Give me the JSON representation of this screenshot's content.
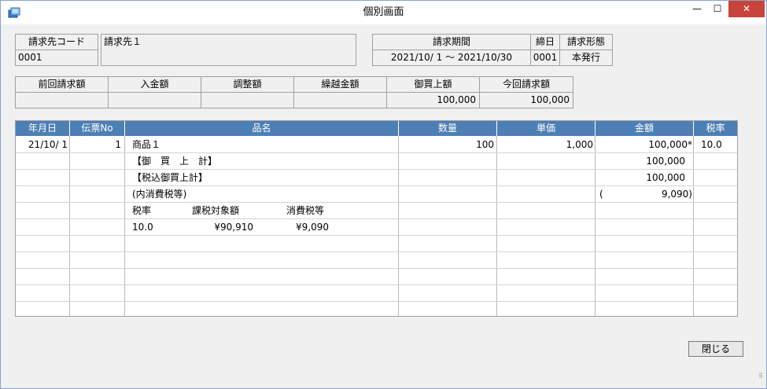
{
  "window": {
    "title": "個別画面",
    "minimize": "—",
    "maximize": "☐",
    "close": "✕",
    "icon": "app-icon"
  },
  "customer": {
    "code_label": "請求先コード",
    "code_value": "0001",
    "name_value": "請求先１"
  },
  "billing": {
    "period_label": "請求期間",
    "period_value": "2021/10/ 1 〜 2021/10/30",
    "closing_label": "締日",
    "closing_value": "0001",
    "format_label": "請求形態",
    "format_value": "本発行"
  },
  "summary": {
    "headers": [
      "前回請求額",
      "入金額",
      "調整額",
      "繰越金額",
      "御買上額",
      "今回請求額"
    ],
    "values": [
      "",
      "",
      "",
      "",
      "100,000",
      "100,000"
    ]
  },
  "grid": {
    "columns": [
      "年月日",
      "伝票No",
      "品名",
      "数量",
      "単価",
      "金額",
      "税率"
    ],
    "row1": {
      "date": "21/10/ 1",
      "slip": "1",
      "item": "商品１",
      "qty": "100",
      "price": "1,000",
      "amount": "100,000*",
      "tax": "10.0"
    },
    "row2": {
      "item": "【御　買　上　計】",
      "amount": "100,000"
    },
    "row3": {
      "item": "【税込御買上計】",
      "amount": "100,000"
    },
    "row4": {
      "item": "(内消費税等)",
      "amount_open": "(",
      "amount": "9,090)"
    },
    "row5": {
      "c1": "税率",
      "c2": "課税対象額",
      "c3": "消費税等"
    },
    "row6": {
      "c1": "10.0",
      "c2": "¥90,910",
      "c3": "¥9,090"
    }
  },
  "buttons": {
    "close_label": "閉じる"
  }
}
